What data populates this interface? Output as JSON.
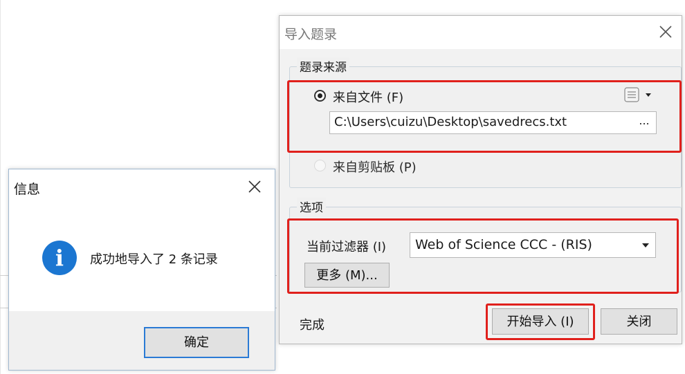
{
  "import_dialog": {
    "title": "导入题录",
    "source_group": {
      "legend": "题录来源",
      "from_file_label": "来自文件 (F)",
      "file_path": "C:\\Users\\cuizu\\Desktop\\savedrecs.txt",
      "browse_label": "...",
      "from_clipboard_label": "来自剪贴板 (P)",
      "selected": "from_file"
    },
    "options_group": {
      "legend": "选项",
      "filter_label": "当前过滤器 (I)",
      "filter_value": "Web of Science CCC - (RIS)",
      "more_button": "更多 (M)..."
    },
    "status": "完成",
    "start_import_button": "开始导入 (I)",
    "close_button": "关闭",
    "highlight_color": "#e0201c"
  },
  "info_dialog": {
    "title": "信息",
    "message": "成功地导入了 2 条记录",
    "ok_button": "确定",
    "icon": "info-icon",
    "icon_color": "#1b76d1"
  }
}
